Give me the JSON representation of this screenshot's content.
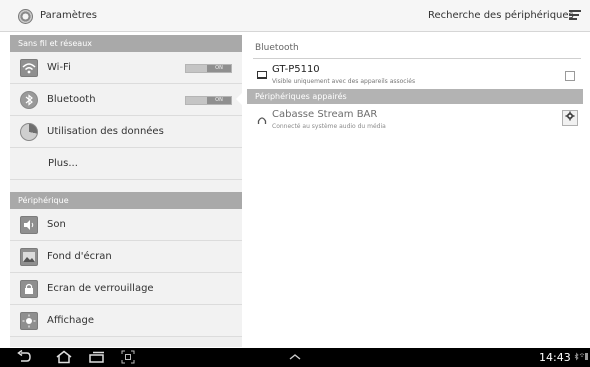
{
  "header": {
    "app_title": "Paramètres",
    "app_icon": "settings-gear-icon",
    "scan_label": "Recherche des périphériques",
    "menu_icon": "overflow-menu-icon"
  },
  "sidebar": {
    "sections": [
      {
        "header": "Sans fil et réseaux",
        "items": [
          {
            "label": "Wi-Fi",
            "icon": "wifi-icon",
            "toggle": "ON"
          },
          {
            "label": "Bluetooth",
            "icon": "bluetooth-icon",
            "toggle": "ON"
          },
          {
            "label": "Utilisation des données",
            "icon": "data-usage-icon"
          },
          {
            "label": "Plus...",
            "icon": ""
          }
        ]
      },
      {
        "header": "Périphérique",
        "items": [
          {
            "label": "Son",
            "icon": "speaker-icon"
          },
          {
            "label": "Fond d'écran",
            "icon": "wallpaper-icon"
          },
          {
            "label": "Ecran de verrouillage",
            "icon": "lock-icon"
          },
          {
            "label": "Affichage",
            "icon": "display-icon"
          }
        ]
      }
    ]
  },
  "bluetooth": {
    "heading": "Bluetooth",
    "this_device": {
      "name": "GT-P5110",
      "subtitle": "Visible uniquement avec des appareils associés",
      "icon": "tablet-icon"
    },
    "paired_header": "Périphériques appairés",
    "paired_devices": [
      {
        "name": "Cabasse Stream BAR",
        "subtitle": "Connecté au système audio du média",
        "icon": "headphones-icon"
      }
    ]
  },
  "system_bar": {
    "time": "14:43",
    "buttons": [
      "back-icon",
      "home-icon",
      "recent-apps-icon",
      "screenshot-icon",
      "up-chevron-icon"
    ]
  },
  "colors": {
    "section_header_bg": "#a9a9a9",
    "sidebar_bg": "#efefef",
    "nav_bar_bg": "#000000"
  }
}
